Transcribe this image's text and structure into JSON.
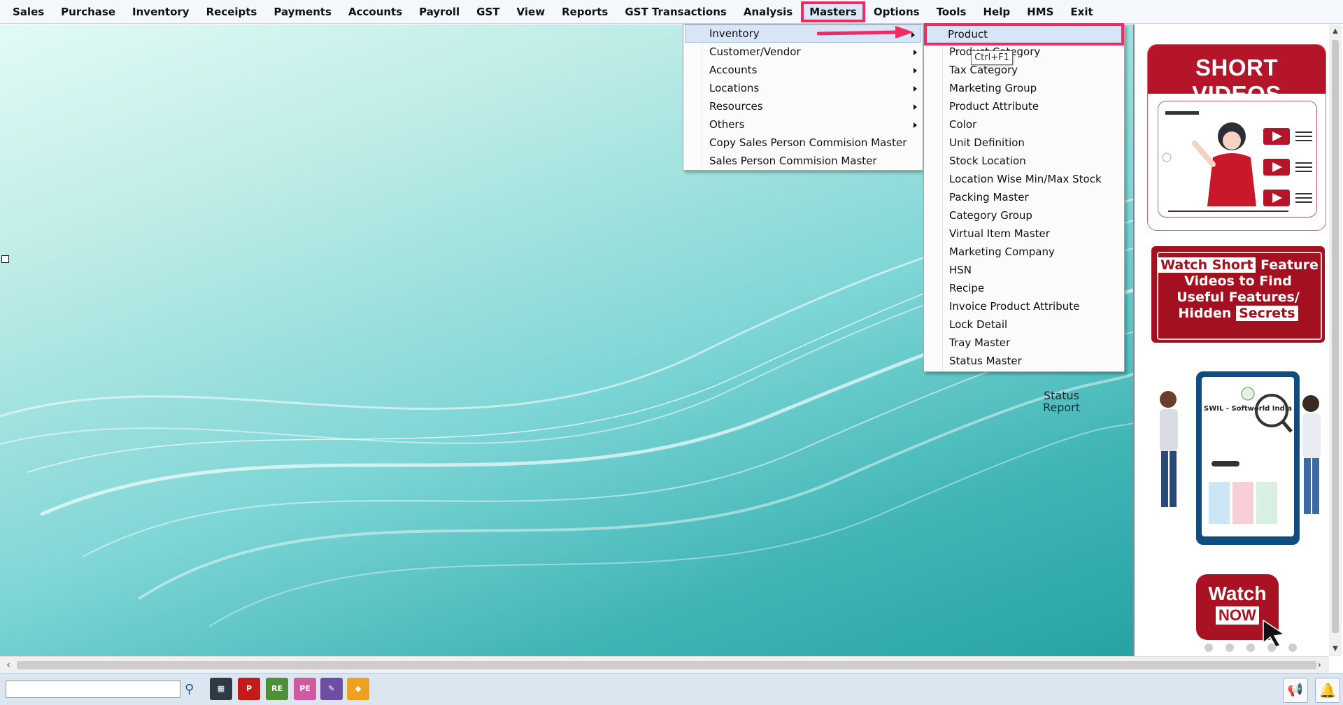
{
  "menubar": {
    "items": [
      "Sales",
      "Purchase",
      "Inventory",
      "Receipts",
      "Payments",
      "Accounts",
      "Payroll",
      "GST",
      "View",
      "Reports",
      "GST Transactions",
      "Analysis",
      "Masters",
      "Options",
      "Tools",
      "Help",
      "HMS",
      "Exit"
    ],
    "active": "Masters"
  },
  "masters_menu": {
    "items": [
      {
        "label": "Inventory",
        "submenu": true
      },
      {
        "label": "Customer/Vendor",
        "submenu": true
      },
      {
        "label": "Accounts",
        "submenu": true
      },
      {
        "label": "Locations",
        "submenu": true
      },
      {
        "label": "Resources",
        "submenu": true
      },
      {
        "label": "Others",
        "submenu": true
      },
      {
        "label": "Copy Sales Person Commision Master",
        "submenu": false
      },
      {
        "label": "Sales Person Commision Master",
        "submenu": false
      }
    ]
  },
  "inventory_menu": {
    "items": [
      "Product",
      "Product Category",
      "Tax Category",
      "Marketing Group",
      "Product Attribute",
      "Color",
      "Unit Definition",
      "Stock Location",
      "Location Wise Min/Max Stock",
      "Packing Master",
      "Category Group",
      "Virtual Item Master",
      "Marketing Company",
      "HSN",
      "Recipe",
      "Invoice Product Attribute",
      "Lock Detail",
      "Tray Master",
      "Status Master"
    ],
    "tooltip": "Ctrl+F1"
  },
  "desktop": {
    "status_report_line1": "Status",
    "status_report_line2": "Report"
  },
  "promo": {
    "short_videos_title": "SHORT VIDEOS",
    "feature_hl1": "Watch Short",
    "feature_line1": "Feature",
    "feature_line2": "Videos to Find",
    "feature_line3": "Useful Features/",
    "feature_line4": "Hidden",
    "feature_hl2": "Secrets",
    "channel_name": "SWIL - Softworld India",
    "watch_word": "Watch",
    "now_word": "NOW"
  },
  "taskbar": {
    "search_value": "",
    "icons": [
      "calculator-icon",
      "p-report-icon",
      "re-icon",
      "pe-icon",
      "stamp-icon",
      "shapes-icon"
    ]
  },
  "colors": {
    "highlight": "#ee2b62",
    "menu_selected": "#d7e5f6",
    "promo_red": "#b41528"
  }
}
